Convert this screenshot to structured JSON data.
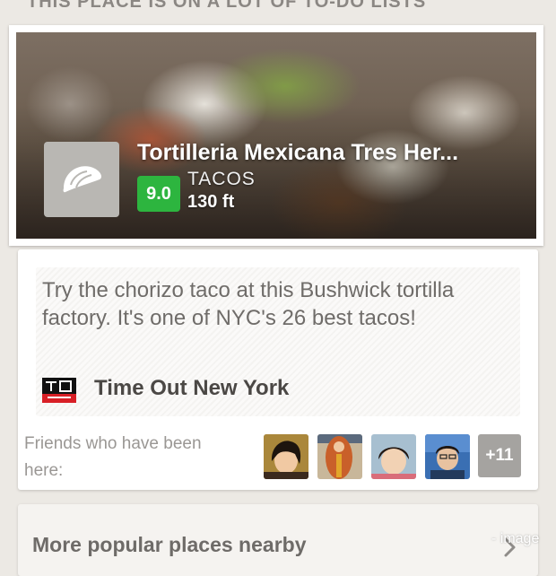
{
  "section_header": "THIS PLACE IS ON A LOT OF TO-DO LISTS",
  "venue": {
    "name": "Tortilleria Mexicana Tres Her...",
    "score": "9.0",
    "category": "TACOS",
    "distance": "130 ft",
    "category_icon": "taco-icon",
    "score_color": "#2db53f"
  },
  "tip": {
    "text": "Try the chorizo taco at this Bushwick tortilla factory. It's one of NYC's 26 best tacos!",
    "source_name": "Time Out New York",
    "source_logo_icon": "time-out-logo-icon"
  },
  "friends": {
    "label": "Friends who have been here:",
    "more_count": "+11",
    "avatars": [
      "friend-avatar-1",
      "friend-avatar-2",
      "friend-avatar-3",
      "friend-avatar-4"
    ]
  },
  "nearby": {
    "title": "More popular places nearby",
    "chevron_icon": "chevron-right-icon"
  },
  "watermark": "- image"
}
